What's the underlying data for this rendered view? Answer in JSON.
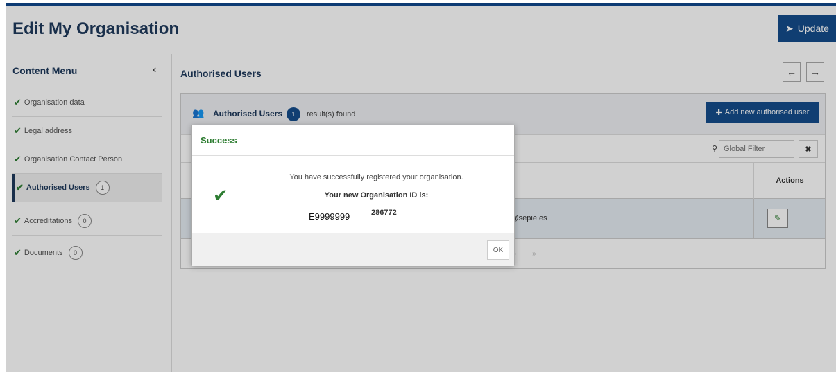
{
  "header": {
    "title": "Edit My Organisation",
    "update_label": "Update"
  },
  "sidebar": {
    "title": "Content Menu",
    "items": [
      {
        "label": "Organisation data",
        "count": ""
      },
      {
        "label": "Legal address",
        "count": ""
      },
      {
        "label": "Organisation Contact Person",
        "count": ""
      },
      {
        "label": "Authorised Users",
        "count": "1"
      },
      {
        "label": "Accreditations",
        "count": "0"
      },
      {
        "label": "Documents",
        "count": "0"
      }
    ]
  },
  "main": {
    "title": "Authorised Users",
    "panel": {
      "label": "Authorised Users",
      "result_count": "1",
      "result_text": "result(s) found",
      "add_button_label": "Add new authorised user",
      "filter_placeholder": "Global Filter",
      "actions_header": "Actions",
      "row_email_partial": "z@sepie.es"
    }
  },
  "modal": {
    "title": "Success",
    "message": "You have successfully registered your organisation.",
    "id_label": "Your new Organisation ID is:",
    "new_id": "E9999999",
    "id_value": "286772",
    "ok_label": "OK"
  },
  "colors": {
    "brand": "#144c8c",
    "success": "#2e7d32",
    "title": "#1f3a5c"
  }
}
